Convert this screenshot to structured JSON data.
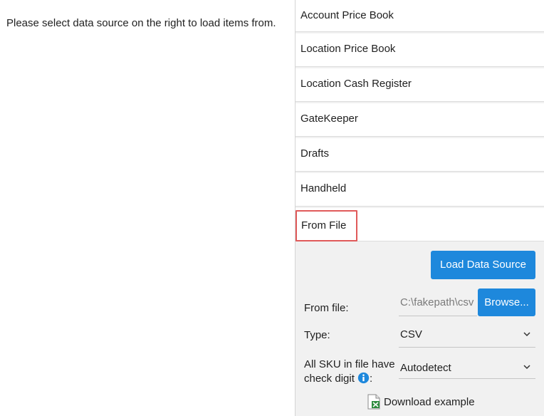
{
  "left": {
    "message": "Please select data source on the right to load items from."
  },
  "sources": [
    {
      "label": "Account Price Book",
      "selected": false
    },
    {
      "label": "Location Price Book",
      "selected": false
    },
    {
      "label": "Location Cash Register",
      "selected": false
    },
    {
      "label": "GateKeeper",
      "selected": false
    },
    {
      "label": "Drafts",
      "selected": false
    },
    {
      "label": "Handheld",
      "selected": false
    },
    {
      "label": "From File",
      "selected": true
    }
  ],
  "form": {
    "load_button": "Load Data Source",
    "from_file_label": "From file:",
    "file_path_value": "C:\\fakepath\\csv",
    "browse_button": "Browse...",
    "type_label": "Type:",
    "type_value": "CSV",
    "sku_label_line1": "All SKU in file have",
    "sku_label_line2": "check digit",
    "sku_label_colon": ":",
    "sku_value": "Autodetect",
    "download_link": "Download example"
  },
  "colors": {
    "accent": "#1e88dc",
    "selected_outline": "#e05a5a",
    "panel_bg": "#f1f1f1"
  }
}
